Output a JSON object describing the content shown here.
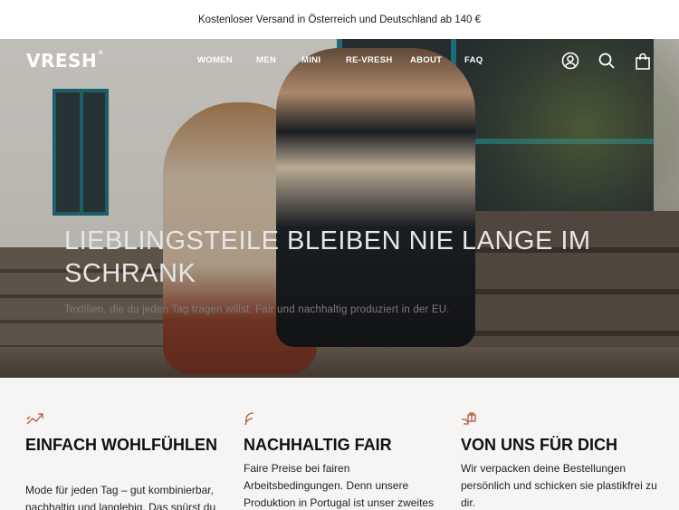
{
  "announcement": {
    "text": "Kostenloser Versand in Österreich und Deutschland ab 140 €"
  },
  "header": {
    "logo": "VRESH",
    "nav": [
      "WOMEN",
      "MEN",
      "MINI",
      "RE-VRESH",
      "ABOUT",
      "FAQ"
    ],
    "icons": [
      "account-icon",
      "search-icon",
      "cart-icon"
    ]
  },
  "hero": {
    "title": "LIEBLINGSTEILE BLEIBEN NIE LANGE IM SCHRANK",
    "subtitle": "Textilien, die du jeden Tag tragen willst. Fair und nachhaltig produziert in der EU."
  },
  "features": [
    {
      "icon": "feather-icon",
      "title": "EINFACH WOHLFÜHLEN",
      "text": "Mode für jeden Tag – gut kombinierbar, nachhaltig und langlebig. Das spürst du"
    },
    {
      "icon": "leaf-icon",
      "title": "NACHHALTIG FAIR",
      "text": "Faire Preise bei fairen Arbeitsbedingungen. Denn unsere Produktion in Portugal ist unser zweites"
    },
    {
      "icon": "gift-hand-icon",
      "title": "VON UNS FÜR DICH",
      "text": "Wir verpacken deine Bestellungen persönlich und schicken sie plastikfrei zu dir."
    }
  ],
  "colors": {
    "accent": "#b05a3c",
    "background": "#f6f5f3",
    "text": "#111111"
  }
}
